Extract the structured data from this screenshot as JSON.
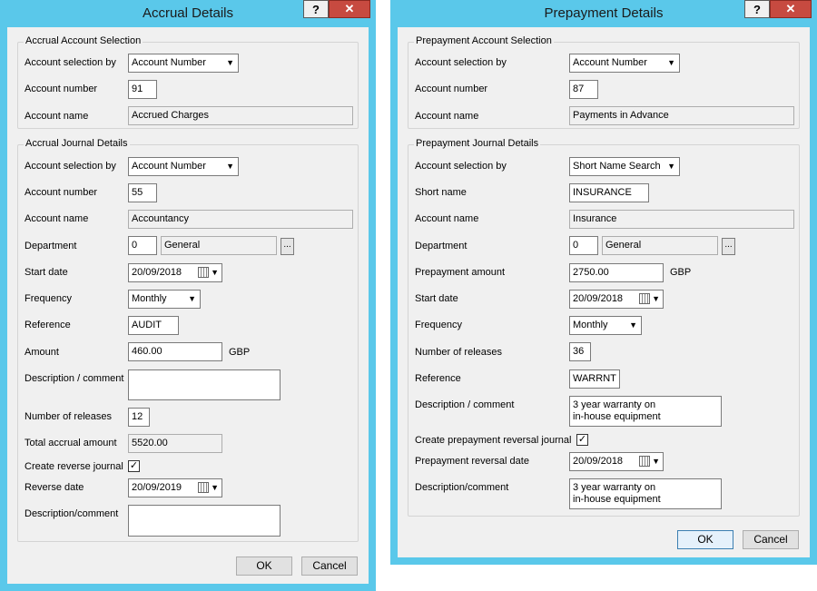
{
  "accrual": {
    "title": "Accrual Details",
    "help_label": "?",
    "close_label": "✕",
    "account_group": {
      "title": "Accrual Account Selection",
      "selection_label": "Account selection by",
      "selection_value": "Account Number",
      "number_label": "Account number",
      "number_value": "91",
      "name_label": "Account name",
      "name_value": "Accrued Charges"
    },
    "journal_group": {
      "title": "Accrual Journal Details",
      "selection_label": "Account selection by",
      "selection_value": "Account Number",
      "number_label": "Account number",
      "number_value": "55",
      "name_label": "Account name",
      "name_value": "Accountancy",
      "department_label": "Department",
      "department_code": "0",
      "department_name": "General",
      "ellipsis": "...",
      "start_date_label": "Start date",
      "start_date_value": "20/09/2018",
      "frequency_label": "Frequency",
      "frequency_value": "Monthly",
      "reference_label": "Reference",
      "reference_value": "AUDIT",
      "amount_label": "Amount",
      "amount_value": "460.00",
      "currency": "GBP",
      "description_label": "Description / comment",
      "description_value": "",
      "releases_label": "Number of releases",
      "releases_value": "12",
      "total_label": "Total accrual amount",
      "total_value": "5520.00",
      "reverse_label": "Create reverse journal",
      "reverse_checked": "✓",
      "reverse_date_label": "Reverse date",
      "reverse_date_value": "20/09/2019",
      "description2_label": "Description/comment",
      "description2_value": ""
    },
    "ok_label": "OK",
    "cancel_label": "Cancel"
  },
  "prepayment": {
    "title": "Prepayment Details",
    "help_label": "?",
    "close_label": "✕",
    "account_group": {
      "title": "Prepayment Account Selection",
      "selection_label": "Account selection by",
      "selection_value": "Account Number",
      "number_label": "Account number",
      "number_value": "87",
      "name_label": "Account name",
      "name_value": "Payments in Advance"
    },
    "journal_group": {
      "title": "Prepayment Journal Details",
      "selection_label": "Account selection by",
      "selection_value": "Short Name Search",
      "short_name_label": "Short name",
      "short_name_value": "INSURANCE",
      "name_label": "Account name",
      "name_value": "Insurance",
      "department_label": "Department",
      "department_code": "0",
      "department_name": "General",
      "ellipsis": "...",
      "amount_label": "Prepayment amount",
      "amount_value": "2750.00",
      "currency": "GBP",
      "start_date_label": "Start date",
      "start_date_value": "20/09/2018",
      "frequency_label": "Frequency",
      "frequency_value": "Monthly",
      "releases_label": "Number of releases",
      "releases_value": "36",
      "reference_label": "Reference",
      "reference_value": "WARRNT",
      "description_label": "Description / comment",
      "description_value": "3 year warranty on\nin-house equipment",
      "reversal_label": "Create prepayment reversal journal",
      "reversal_checked": "✓",
      "reversal_date_label": "Prepayment reversal date",
      "reversal_date_value": "20/09/2018",
      "description2_label": "Description/comment",
      "description2_value": "3 year warranty on\nin-house equipment"
    },
    "ok_label": "OK",
    "cancel_label": "Cancel"
  }
}
